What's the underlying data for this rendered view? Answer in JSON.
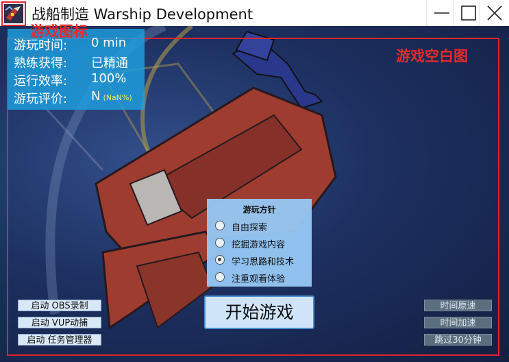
{
  "window": {
    "title": "战船制造 Warship Development",
    "app_icon": "warship-game-icon",
    "controls": {
      "minimize": "minimize-icon",
      "maximize": "maximize-icon",
      "close": "close-icon"
    }
  },
  "annotations": {
    "icon_label": "游戏图标",
    "blank_label": "游戏空白图",
    "color": "#e0252a"
  },
  "stats": [
    {
      "label": "游玩时间:",
      "value": "0 min",
      "sub": ""
    },
    {
      "label": "熟练获得:",
      "value": "已精通",
      "sub": ""
    },
    {
      "label": "运行效率:",
      "value": "100%",
      "sub": ""
    },
    {
      "label": "游玩评价:",
      "value": "N",
      "sub": "(NaN%)"
    }
  ],
  "strategy": {
    "title": "游玩方针",
    "options": [
      {
        "label": "自由探索",
        "checked": false
      },
      {
        "label": "挖掘游戏内容",
        "checked": false
      },
      {
        "label": "学习思路和技术",
        "checked": true
      },
      {
        "label": "注重观看体验",
        "checked": false
      }
    ]
  },
  "start_button": "开始游戏",
  "left_buttons": [
    "启动 OBS录制",
    "启动 VUP动捕",
    "启动 任务管理器"
  ],
  "right_buttons": [
    "时间原速",
    "时间加速",
    "跳过30分钟"
  ],
  "colors": {
    "stats_panel": "#1ea0e1",
    "stats_sub": "#ffe85a",
    "strategy_panel": "#96c8f5",
    "start_border": "#4a8fd0",
    "time_buttons": "#5b6e7e"
  }
}
